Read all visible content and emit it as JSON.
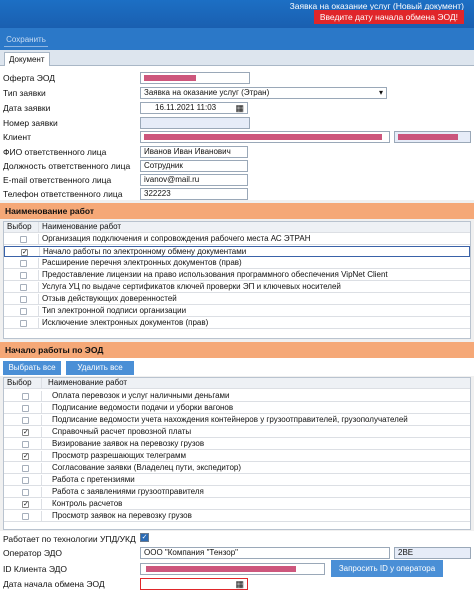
{
  "window": {
    "title": "Заявка на оказание услуг (Новый документ)",
    "error_banner": "Введите дату начала обмена ЭОД!"
  },
  "toolbar": {
    "save_label": "Сохранить (Ctrl+S)"
  },
  "tabs": [
    {
      "label": "Документ"
    }
  ],
  "form": {
    "fields": [
      {
        "label": "Оферта ЭОД",
        "value": ""
      },
      {
        "label": "Тип заявки",
        "value": "Заявка на оказание услуг (Этран)"
      },
      {
        "label": "Дата заявки",
        "value": "16.11.2021 11:03"
      },
      {
        "label": "Номер заявки",
        "value": ""
      },
      {
        "label": "Клиент",
        "value": ""
      },
      {
        "label": "ФИО ответственного лица",
        "value": "Иванов Иван Иванович"
      },
      {
        "label": "Должность ответственного лица",
        "value": "Сотрудник"
      },
      {
        "label": "E-mail ответственного лица",
        "value": "ivanov@mail.ru"
      },
      {
        "label": "Телефон ответственного лица",
        "value": "322223"
      }
    ]
  },
  "works_section": {
    "title": "Наименование работ",
    "col_select": "Выбор",
    "col_name": "Наименование работ",
    "rows": [
      {
        "name": "Организация подключения и сопровождения рабочего места АС ЭТРАН",
        "checked": false
      },
      {
        "name": "Начало работы по электронному обмену документами",
        "checked": true
      },
      {
        "name": "Расширение перечня электронных документов (прав)",
        "checked": false
      },
      {
        "name": "Предоставление лицензии на право использования программного обеспечения VipNet Client",
        "checked": false
      },
      {
        "name": "Услуга УЦ по выдаче сертификатов ключей проверки ЭП и ключевых носителей",
        "checked": false
      },
      {
        "name": "Отзыв действующих доверенностей",
        "checked": false
      },
      {
        "name": "Тип электронной подписи организации",
        "checked": false
      },
      {
        "name": "Исключение электронных документов (прав)",
        "checked": false
      }
    ]
  },
  "eod_section": {
    "title": "Начало работы по ЭОД",
    "select_all": "Выбрать все",
    "delete_all": "Удалить все",
    "col_select": "Выбор",
    "col_name": "Наименование работ",
    "rows": [
      {
        "name": "Оплата перевозок и услуг наличными деньгами",
        "checked": false
      },
      {
        "name": "Подписание ведомости подачи и уборки вагонов",
        "checked": false
      },
      {
        "name": "Подписание ведомости учета нахождения контейнеров у грузоотправителей, грузополучателей",
        "checked": false
      },
      {
        "name": "Справочный расчет провозной платы",
        "checked": true
      },
      {
        "name": "Визирование заявок на перевозку грузов",
        "checked": false
      },
      {
        "name": "Просмотр разрешающих телеграмм",
        "checked": true
      },
      {
        "name": "Согласование заявки (Владелец пути, экспедитор)",
        "checked": false
      },
      {
        "name": "Работа с претензиями",
        "checked": false
      },
      {
        "name": "Работа с заявлениями грузоотправителя",
        "checked": false
      },
      {
        "name": "Контроль расчетов",
        "checked": true
      },
      {
        "name": "Просмотр заявок на перевозку грузов",
        "checked": false
      }
    ]
  },
  "footer": {
    "upd_label": "Работает по технологии УПД/УКД",
    "upd_checked": true,
    "operator_label": "Оператор ЭДО",
    "operator_value": "ООО \"Компания \"Тензор\"",
    "operator_code": "2BE",
    "client_id_label": "ID Клиента ЭДО",
    "client_id_value": "",
    "request_button": "Запросить ID у оператора",
    "start_date_label": "Дата начала обмена ЭОД",
    "start_date_value": ""
  },
  "colors": {
    "accent": "#2b78c8",
    "section_header": "#f5a877",
    "error": "#e0262a",
    "redaction": "#c43a66"
  },
  "icons": [
    "calendar-icon",
    "dropdown-arrow-icon",
    "checkmark-icon"
  ]
}
